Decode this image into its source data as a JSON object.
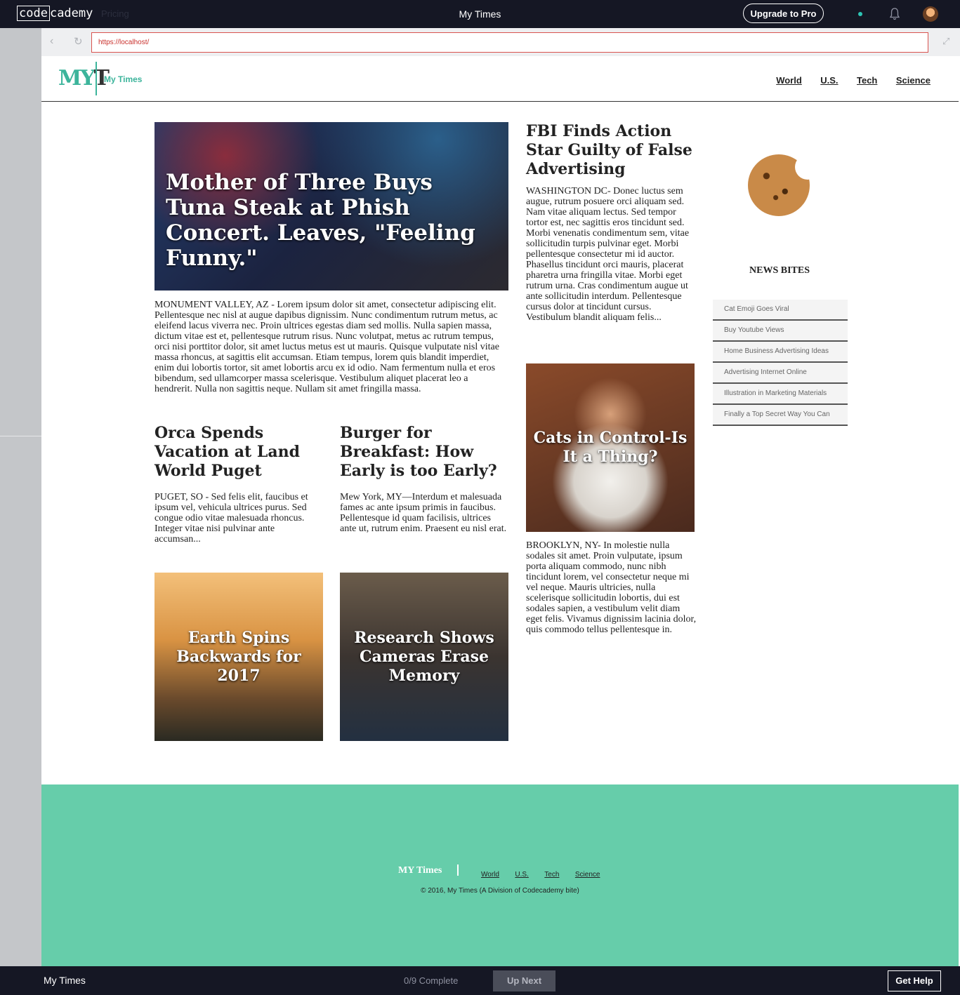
{
  "app": {
    "logo_a": "code",
    "logo_b": "cademy",
    "pricing": "Pricing",
    "title": "My Times",
    "upgrade": "Upgrade to Pro"
  },
  "browser": {
    "back": "‹",
    "reload": "↻",
    "url": "https://localhost/",
    "expand": "⤢"
  },
  "site": {
    "logo_my": "MY",
    "logo_t": "T",
    "brand": "My Times",
    "nav": [
      "World",
      "U.S.",
      "Tech",
      "Science"
    ],
    "hero": {
      "title": "Mother of Three Buys Tuna Steak at Phish Concert. Leaves, \"Feeling Funny.\"",
      "text": "MONUMENT VALLEY, AZ - Lorem ipsum dolor sit amet, consectetur adipiscing elit. Pellentesque nec nisl at augue dapibus dignissim. Nunc condimentum rutrum metus, ac eleifend lacus viverra nec. Proin ultrices egestas diam sed mollis. Nulla sapien massa, dictum vitae est et, pellentesque rutrum risus. Nunc volutpat, metus ac rutrum tempus, orci nisi porttitor dolor, sit amet luctus metus est ut mauris. Quisque vulputate nisl vitae massa rhoncus, at sagittis elit accumsan. Etiam tempus, lorem quis blandit imperdiet, enim dui lobortis tortor, sit amet lobortis arcu ex id odio. Nam fermentum nulla et eros bibendum, sed ullamcorper massa scelerisque. Vestibulum aliquet placerat leo a hendrerit. Nulla non sagittis neque. Nullam sit amet fringilla massa."
    },
    "orca": {
      "title": "Orca Spends Vacation at Land World Puget",
      "text": "PUGET, SO - Sed felis elit, faucibus et ipsum vel, vehicula ultrices purus. Sed congue odio vitae malesuada rhoncus. Integer vitae nisi pulvinar ante accumsan..."
    },
    "burger": {
      "title": "Burger for Breakfast: How Early is too Early?",
      "text": "Mew York, MY—Interdum et malesuada fames ac ante ipsum primis in faucibus. Pellentesque id quam facilisis, ultrices ante ut, rutrum enim. Praesent eu nisl erat."
    },
    "earth_title": "Earth Spins Backwards for 2017",
    "camera_title": "Research Shows Cameras Erase Memory",
    "fbi": {
      "title": "FBI Finds Action Star Guilty of False Advertising",
      "text": "WASHINGTON DC- Donec luctus sem augue, rutrum posuere orci aliquam sed. Nam vitae aliquam lectus. Sed tempor tortor est, nec sagittis eros tincidunt sed. Morbi venenatis condimentum sem, vitae sollicitudin turpis pulvinar eget. Morbi pellentesque consectetur mi id auctor. Phasellus tincidunt orci mauris, placerat pharetra urna fringilla vitae. Morbi eget rutrum urna. Cras condimentum augue ut ante sollicitudin interdum. Pellentesque cursus dolor at tincidunt cursus. Vestibulum blandit aliquam felis..."
    },
    "cat": {
      "title": "Cats in Control-Is It a Thing?",
      "text": "BROOKLYN, NY- In molestie nulla sodales sit amet. Proin vulputate, ipsum porta aliquam commodo, nunc nibh tincidunt lorem, vel consectetur neque mi vel neque. Mauris ultricies, nulla scelerisque sollicitudin lobortis, dui est sodales sapien, a vestibulum velit diam eget felis. Vivamus dignissim lacinia dolor, quis commodo tellus pellentesque in."
    },
    "news_bites_heading": "NEWS BITES",
    "news_bites": [
      "Cat Emoji Goes Viral",
      "Buy Youtube Views",
      "Home Business Advertising Ideas",
      "Advertising Internet Online",
      "Illustration in Marketing Materials",
      "Finally a Top Secret Way You Can"
    ],
    "footer": {
      "brand": "MY Times",
      "nav": [
        "World",
        "U.S.",
        "Tech",
        "Science"
      ],
      "copyright": "© 2016, My Times (A Division of Codecademy bite)"
    }
  },
  "bottom": {
    "title": "My Times",
    "progress": "0/9 Complete",
    "up_next": "Up Next",
    "get_help": "Get Help"
  },
  "colors": {
    "accent": "#3cb49b",
    "footer_bg": "#66cdaa",
    "bar_bg": "#151724"
  },
  "icons": [
    "bell-icon",
    "back-icon",
    "reload-icon",
    "expand-icon"
  ]
}
